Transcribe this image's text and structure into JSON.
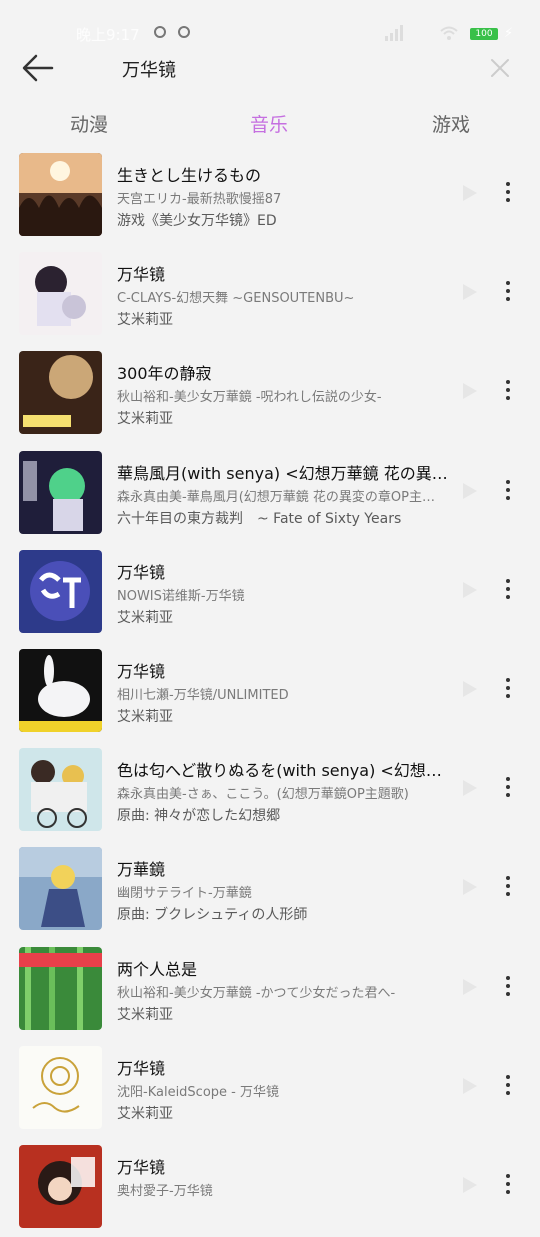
{
  "status_bar": {
    "time": "晚上9:17",
    "battery": "100"
  },
  "search": {
    "query": "万华镜"
  },
  "tabs": [
    {
      "label": "动漫",
      "active": false
    },
    {
      "label": "音乐",
      "active": true
    },
    {
      "label": "游戏",
      "active": false
    }
  ],
  "colors": {
    "accent": "#c56fe0",
    "battery": "#39c049"
  },
  "songs": [
    {
      "title": "生きとし生けるもの",
      "artist_album": "天宫エリカ-最新热歌慢摇87",
      "source": "游戏《美少女万华镜》ED",
      "cover_icon": "concert-crowd-cover"
    },
    {
      "title": "万华镜",
      "artist_album": "C-CLAYS-幻想天舞 ~GENSOUTENBU~",
      "source": "艾米莉亚",
      "cover_icon": "anime-girl-cover"
    },
    {
      "title": "300年の静寂",
      "artist_album": "秋山裕和-美少女万華鏡 -呪われし伝説の少女-",
      "source": "艾米莉亚",
      "cover_icon": "chandelier-cover"
    },
    {
      "title": "華鳥風月(with senya) <幻想万華鏡 花の異変の章OP>",
      "artist_album": "森永真由美-華鳥風月(幻想万華鏡 花の異変の章OP主題歌)",
      "source": "六十年目の東方裁判　~ Fate of Sixty Years",
      "cover_icon": "green-hair-girl-cover"
    },
    {
      "title": "万华镜",
      "artist_album": "NOWIS诺维斯-万华镜",
      "source": "艾米莉亚",
      "cover_icon": "nowis-logo-cover"
    },
    {
      "title": "万华镜",
      "artist_album": "相川七瀬-万华镜/UNLIMITED",
      "source": "艾米莉亚",
      "cover_icon": "white-rabbit-cover"
    },
    {
      "title": "色は匂へど散りぬるを(with senya) <幻想万華鏡OP>",
      "artist_album": "森永真由美-さぁ、ここう。(幻想万華鏡OP主題歌)",
      "source": "原曲: 神々が恋した幻想郷",
      "cover_icon": "bicycle-girls-cover"
    },
    {
      "title": "万華鏡",
      "artist_album": "幽閉サテライト-万華鏡",
      "source": "原曲: ブクレシュティの人形師",
      "cover_icon": "blonde-girl-cover"
    },
    {
      "title": "两个人总是",
      "artist_album": "秋山裕和-美少女万華鏡 -かつて少女だった君へ-",
      "source": "艾米莉亚",
      "cover_icon": "bamboo-forest-cover"
    },
    {
      "title": "万华镜",
      "artist_album": "沈阳-KaleidScope - 万华镜",
      "source": "艾米莉亚",
      "cover_icon": "kaleidoscope-logo-cover"
    },
    {
      "title": "万华镜",
      "artist_album": "奥村愛子-万华镜",
      "source": "",
      "cover_icon": "red-portrait-cover"
    }
  ]
}
